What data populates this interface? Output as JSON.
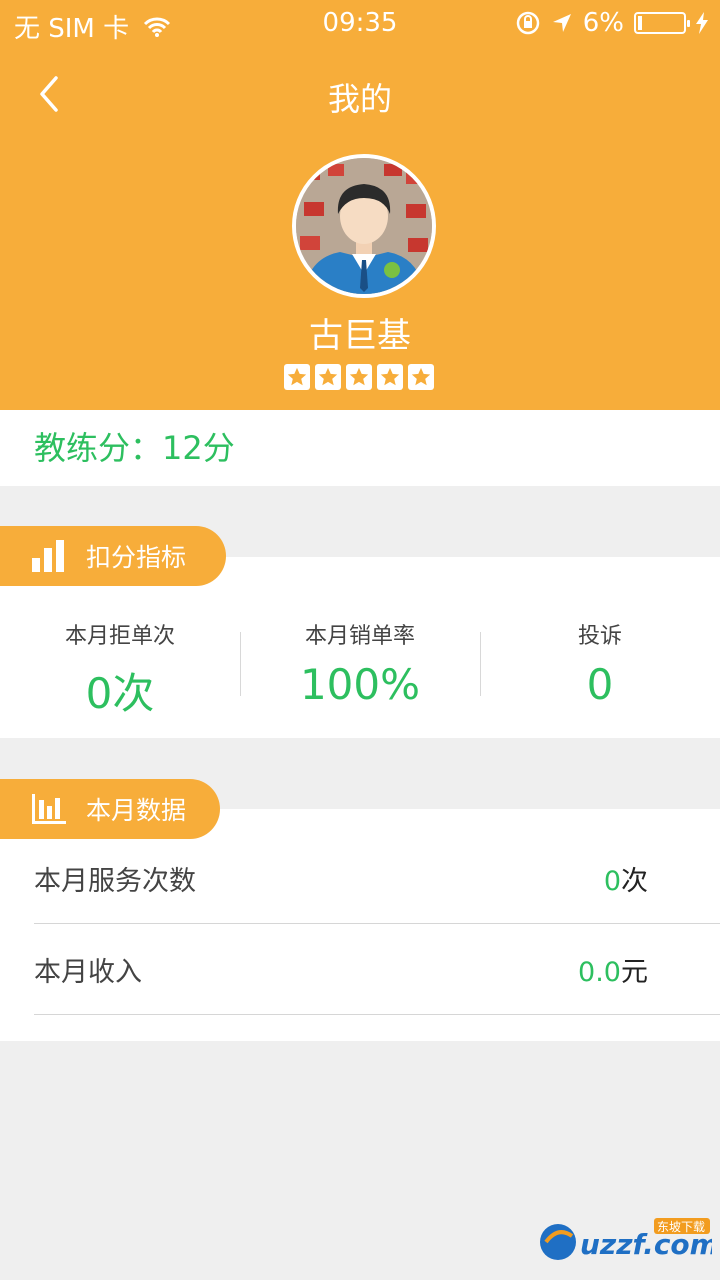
{
  "status_bar": {
    "carrier": "无 SIM 卡",
    "time": "09:35",
    "battery": "6%",
    "icons": [
      "wifi-icon",
      "rotation-lock-icon",
      "location-arrow-icon",
      "battery-icon",
      "charging-bolt-icon"
    ]
  },
  "nav": {
    "title": "我的",
    "back_icon": "chevron-left-icon"
  },
  "profile": {
    "name": "古巨基",
    "rating_stars": 5
  },
  "score": {
    "text": "教练分：12分"
  },
  "deduction_section": {
    "title": "扣分指标",
    "icon": "bar-chart-icon",
    "metrics": [
      {
        "label": "本月拒单次",
        "value": "0次"
      },
      {
        "label": "本月销单率",
        "value": "100%"
      },
      {
        "label": "投诉",
        "value": "0"
      }
    ]
  },
  "monthly_section": {
    "title": "本月数据",
    "icon": "column-chart-icon",
    "rows": [
      {
        "label": "本月服务次数",
        "value": "0",
        "unit": "次"
      },
      {
        "label": "本月收入",
        "value": "0.0",
        "unit": "元"
      }
    ]
  },
  "colors": {
    "accent": "#f7ad3a",
    "green": "#2dbf5f",
    "background": "#efefef"
  },
  "watermark": {
    "text": "uzzf.com",
    "tag": "东坡下载"
  }
}
